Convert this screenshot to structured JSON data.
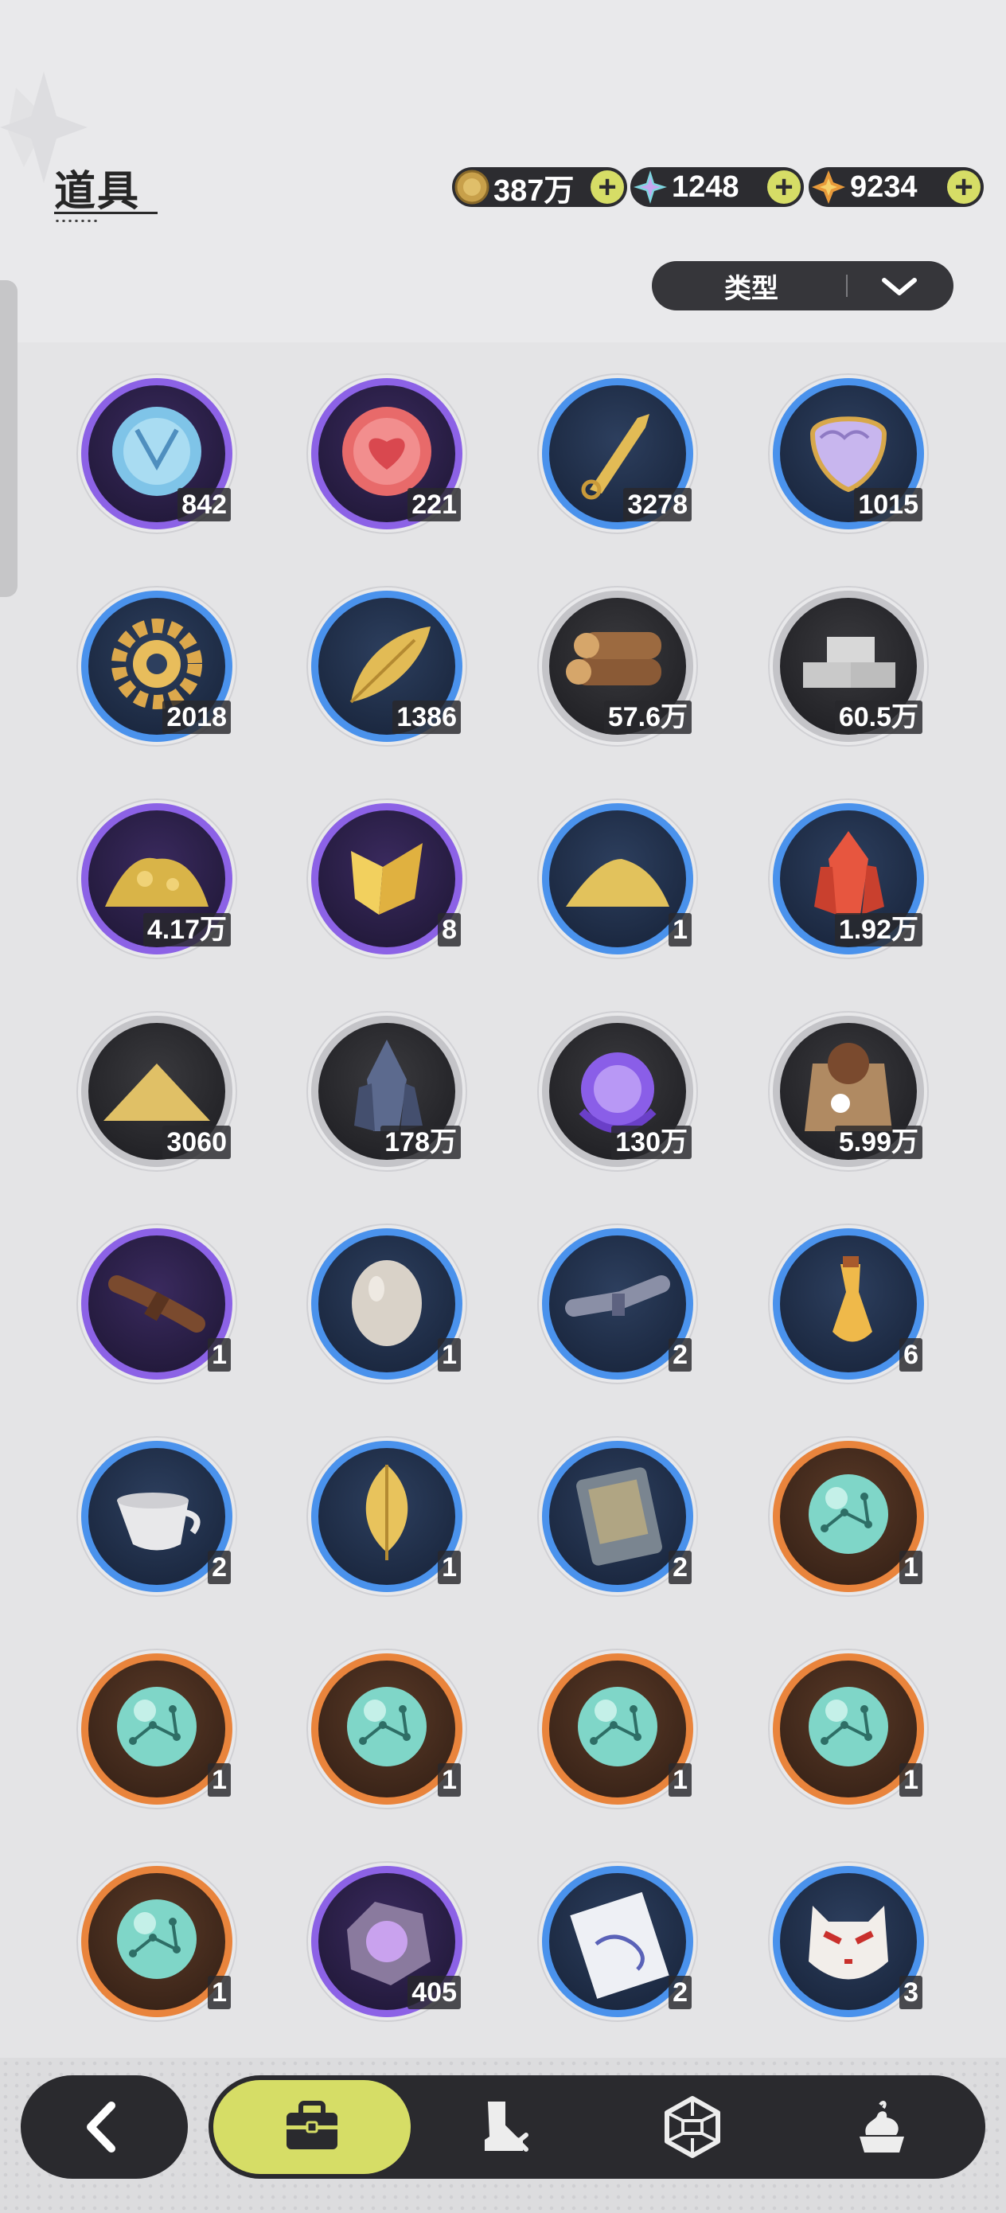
{
  "header": {
    "title": "道具",
    "currencies": [
      {
        "name": "coin",
        "value": "387万",
        "color": "#c8a04a"
      },
      {
        "name": "crystal",
        "value": "1248",
        "color": "#7fd6e0"
      },
      {
        "name": "star-shard",
        "value": "9234",
        "color": "#e89a3a"
      }
    ],
    "add_symbol": "+",
    "filter_label": "类型"
  },
  "items": [
    {
      "icon": "blue-shield-token-icon",
      "rarity": "purple",
      "qty": "842"
    },
    {
      "icon": "red-heart-token-icon",
      "rarity": "purple",
      "qty": "221"
    },
    {
      "icon": "golden-blade-icon",
      "rarity": "blue",
      "qty": "3278"
    },
    {
      "icon": "scale-shield-icon",
      "rarity": "blue",
      "qty": "1015"
    },
    {
      "icon": "golden-gear-icon",
      "rarity": "blue",
      "qty": "2018"
    },
    {
      "icon": "golden-leaf-icon",
      "rarity": "blue",
      "qty": "1386"
    },
    {
      "icon": "wood-logs-icon",
      "rarity": "gray",
      "qty": "57.6万"
    },
    {
      "icon": "stone-bricks-icon",
      "rarity": "gray",
      "qty": "60.5万"
    },
    {
      "icon": "gold-ore-pile-icon",
      "rarity": "purple",
      "qty": "4.17万"
    },
    {
      "icon": "gold-crystal-shards-icon",
      "rarity": "purple",
      "qty": "8"
    },
    {
      "icon": "gold-dust-pile-icon",
      "rarity": "blue",
      "qty": "1"
    },
    {
      "icon": "red-crystal-icon",
      "rarity": "blue",
      "qty": "1.92万"
    },
    {
      "icon": "sand-pile-icon",
      "rarity": "gray",
      "qty": "3060"
    },
    {
      "icon": "dark-crystal-icon",
      "rarity": "gray",
      "qty": "178万"
    },
    {
      "icon": "purple-orb-icon",
      "rarity": "gray",
      "qty": "130万"
    },
    {
      "icon": "seed-sack-icon",
      "rarity": "gray",
      "qty": "5.99万"
    },
    {
      "icon": "fiber-bundle-icon",
      "rarity": "purple",
      "qty": "1"
    },
    {
      "icon": "egg-icon",
      "rarity": "blue",
      "qty": "1"
    },
    {
      "icon": "herb-bundle-icon",
      "rarity": "blue",
      "qty": "2"
    },
    {
      "icon": "potion-vial-icon",
      "rarity": "blue",
      "qty": "6"
    },
    {
      "icon": "teacup-icon",
      "rarity": "blue",
      "qty": "2"
    },
    {
      "icon": "golden-leaves-icon",
      "rarity": "blue",
      "qty": "1"
    },
    {
      "icon": "card-pouch-icon",
      "rarity": "blue",
      "qty": "2"
    },
    {
      "icon": "constellation-orb-icon",
      "rarity": "orange",
      "qty": "1"
    },
    {
      "icon": "constellation-orb-icon",
      "rarity": "orange",
      "qty": "1"
    },
    {
      "icon": "constellation-orb-icon",
      "rarity": "orange",
      "qty": "1"
    },
    {
      "icon": "constellation-orb-icon",
      "rarity": "orange",
      "qty": "1"
    },
    {
      "icon": "constellation-orb-icon",
      "rarity": "orange",
      "qty": "1"
    },
    {
      "icon": "constellation-orb-icon",
      "rarity": "orange",
      "qty": "1"
    },
    {
      "icon": "amethyst-rock-icon",
      "rarity": "purple",
      "qty": "405"
    },
    {
      "icon": "paper-talisman-icon",
      "rarity": "blue",
      "qty": "2"
    },
    {
      "icon": "fox-mask-icon",
      "rarity": "blue",
      "qty": "3"
    }
  ],
  "nav": {
    "back": "back-arrow-icon",
    "tabs": [
      {
        "icon": "briefcase-icon",
        "active": true
      },
      {
        "icon": "boot-sword-icon",
        "active": false
      },
      {
        "icon": "hexagon-gem-icon",
        "active": false
      },
      {
        "icon": "cream-dessert-icon",
        "active": false
      }
    ]
  },
  "colors": {
    "purple": "#7a4fd1",
    "blue": "#3f86e0",
    "gray": "#b9b9bd",
    "orange": "#e07a35",
    "accent": "#d6dd66",
    "dark": "#2a2a2e"
  }
}
